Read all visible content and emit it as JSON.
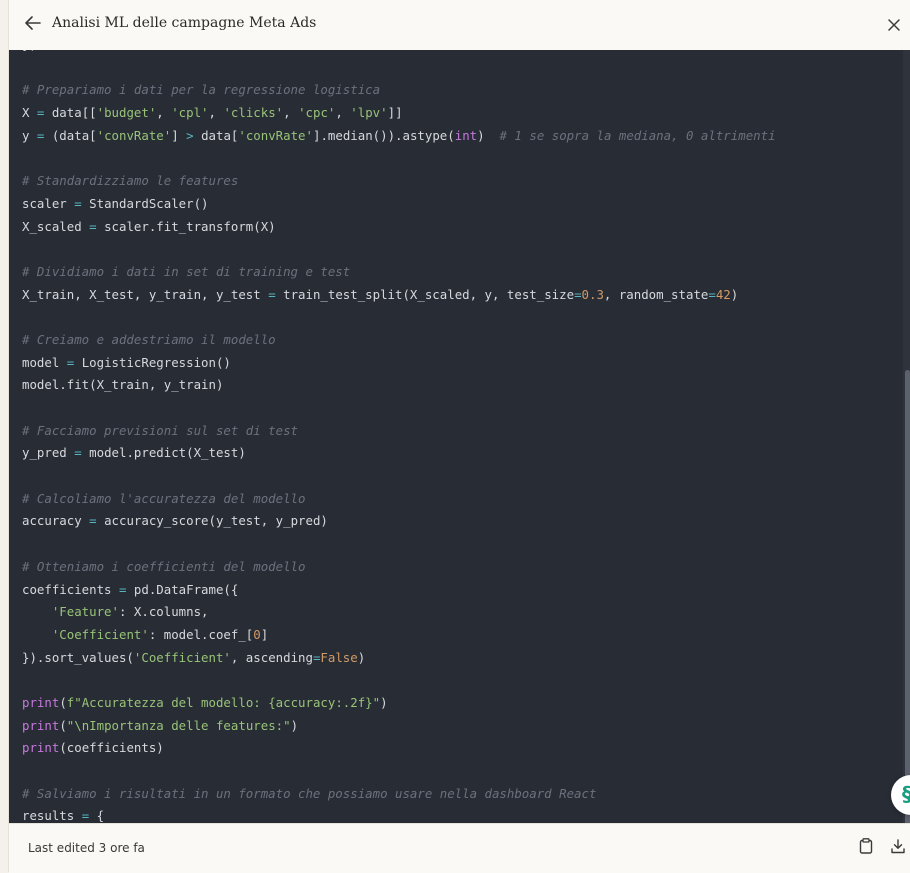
{
  "header": {
    "title": "Analisi ML delle campagne Meta Ads",
    "back_icon": "arrow-left-icon",
    "close_icon": "close-icon"
  },
  "code": {
    "language": "python",
    "lines": [
      "})",
      "",
      "# Prepariamo i dati per la regressione logistica",
      "X = data[['budget', 'cpl', 'clicks', 'cpc', 'lpv']]",
      "y = (data['convRate'] > data['convRate'].median()).astype(int)  # 1 se sopra la mediana, 0 altrimenti",
      "",
      "# Standardizziamo le features",
      "scaler = StandardScaler()",
      "X_scaled = scaler.fit_transform(X)",
      "",
      "# Dividiamo i dati in set di training e test",
      "X_train, X_test, y_train, y_test = train_test_split(X_scaled, y, test_size=0.3, random_state=42)",
      "",
      "# Creiamo e addestriamo il modello",
      "model = LogisticRegression()",
      "model.fit(X_train, y_train)",
      "",
      "# Facciamo previsioni sul set di test",
      "y_pred = model.predict(X_test)",
      "",
      "# Calcoliamo l'accuratezza del modello",
      "accuracy = accuracy_score(y_test, y_pred)",
      "",
      "# Otteniamo i coefficienti del modello",
      "coefficients = pd.DataFrame({",
      "    'Feature': X.columns,",
      "    'Coefficient': model.coef_[0]",
      "}).sort_values('Coefficient', ascending=False)",
      "",
      "print(f\"Accuratezza del modello: {accuracy:.2f}\")",
      "print(\"\\nImportanza delle features:\")",
      "print(coefficients)",
      "",
      "# Salviamo i risultati in un formato che possiamo usare nella dashboard React",
      "results = {"
    ]
  },
  "footer": {
    "last_edited": "Last edited 3 ore fa",
    "copy_icon": "clipboard-icon",
    "download_icon": "download-icon"
  },
  "colors": {
    "code_bg": "#282c34",
    "keyword": "#c678dd",
    "string": "#98c379",
    "number": "#d19a66",
    "operator": "#56b6c2",
    "comment": "#6b717d",
    "accent": "#1a9d7e"
  }
}
